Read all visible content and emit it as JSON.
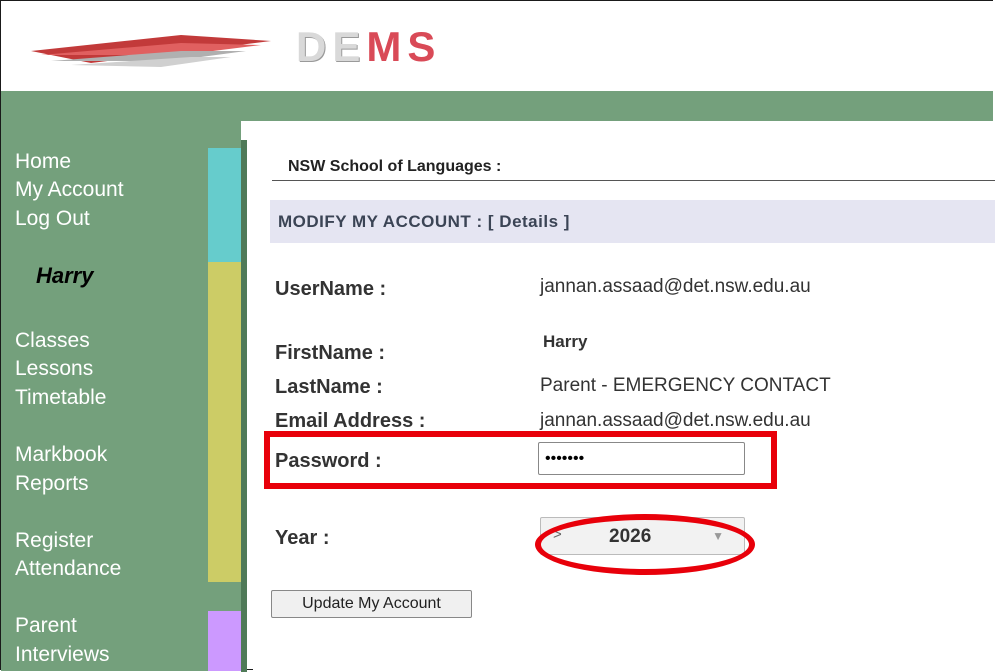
{
  "brand": {
    "name_prefix": "DE",
    "name_suffix": "MS"
  },
  "sidebar": {
    "group1": [
      "Home",
      "My Account",
      "Log Out"
    ],
    "user": "Harry",
    "group2": [
      "Classes",
      "Lessons",
      "Timetable"
    ],
    "group3": [
      "Markbook",
      "Reports"
    ],
    "group4": [
      "Register",
      "Attendance"
    ],
    "group5": [
      "Parent",
      "Interviews"
    ]
  },
  "school": {
    "title": "NSW School of Languages :"
  },
  "section": {
    "title": "MODIFY MY ACCOUNT :   [ Details ]"
  },
  "form": {
    "username": {
      "label": "UserName :",
      "value": "jannan.assaad@det.nsw.edu.au"
    },
    "firstname": {
      "label": "FirstName :",
      "value": "Harry"
    },
    "lastname": {
      "label": "LastName :",
      "value": "Parent - EMERGENCY CONTACT"
    },
    "email": {
      "label": "Email Address :",
      "value": "jannan.assaad@det.nsw.edu.au"
    },
    "password": {
      "label": "Password :",
      "value": "•••••••"
    },
    "year": {
      "label": "Year :",
      "prefix": ">",
      "value": "2026",
      "arrow": "▼"
    },
    "submit_label": "Update My Account"
  },
  "colors": {
    "sidebar_green": "#74a07c",
    "highlight_red": "#e8000a",
    "block_cyan": "#66cccc",
    "block_olive": "#cccc66",
    "block_purple": "#cc99ff"
  }
}
